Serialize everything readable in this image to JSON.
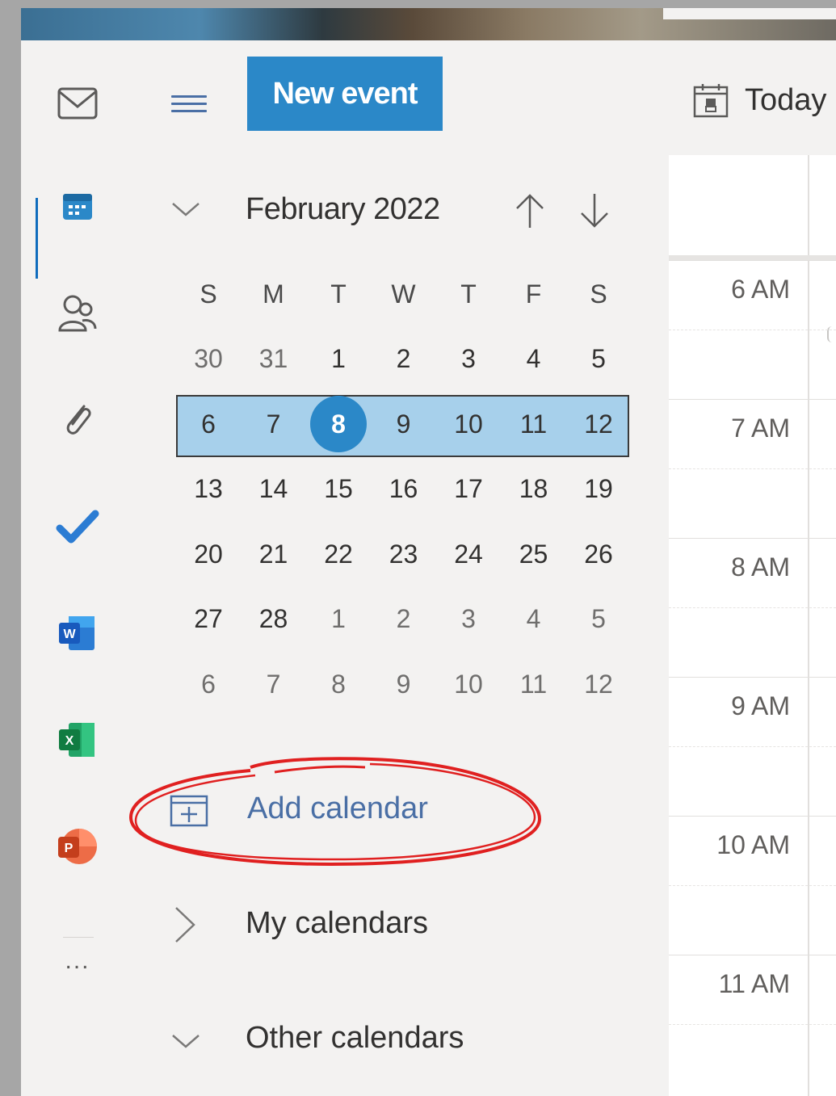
{
  "toolbar": {
    "new_event_label": "New event",
    "today_label": "Today"
  },
  "rail": {
    "items": [
      "mail-icon",
      "calendar-icon",
      "people-icon",
      "attachment-icon",
      "todo-icon",
      "word-icon",
      "excel-icon",
      "powerpoint-icon",
      "more-apps-icon"
    ],
    "more_label": "...",
    "active": "calendar-icon"
  },
  "mini_calendar": {
    "month_label": "February 2022",
    "weekday_headers": [
      "S",
      "M",
      "T",
      "W",
      "T",
      "F",
      "S"
    ],
    "weeks": [
      [
        "30",
        "31",
        "1",
        "2",
        "3",
        "4",
        "5"
      ],
      [
        "6",
        "7",
        "8",
        "9",
        "10",
        "11",
        "12"
      ],
      [
        "13",
        "14",
        "15",
        "16",
        "17",
        "18",
        "19"
      ],
      [
        "20",
        "21",
        "22",
        "23",
        "24",
        "25",
        "26"
      ],
      [
        "27",
        "28",
        "1",
        "2",
        "3",
        "4",
        "5"
      ],
      [
        "6",
        "7",
        "8",
        "9",
        "10",
        "11",
        "12"
      ]
    ],
    "selected_week_index": 1,
    "today": "8",
    "accent_color": "#2b88c8",
    "selection_color": "#a7d0eb"
  },
  "calendars_pane": {
    "add_calendar_label": "Add calendar",
    "my_calendars_label": "My calendars",
    "other_calendars_label": "Other calendars",
    "annotation_color": "#e02020"
  },
  "time_grid": {
    "hours": [
      "6 AM",
      "7 AM",
      "8 AM",
      "9 AM",
      "10 AM",
      "11 AM"
    ]
  }
}
